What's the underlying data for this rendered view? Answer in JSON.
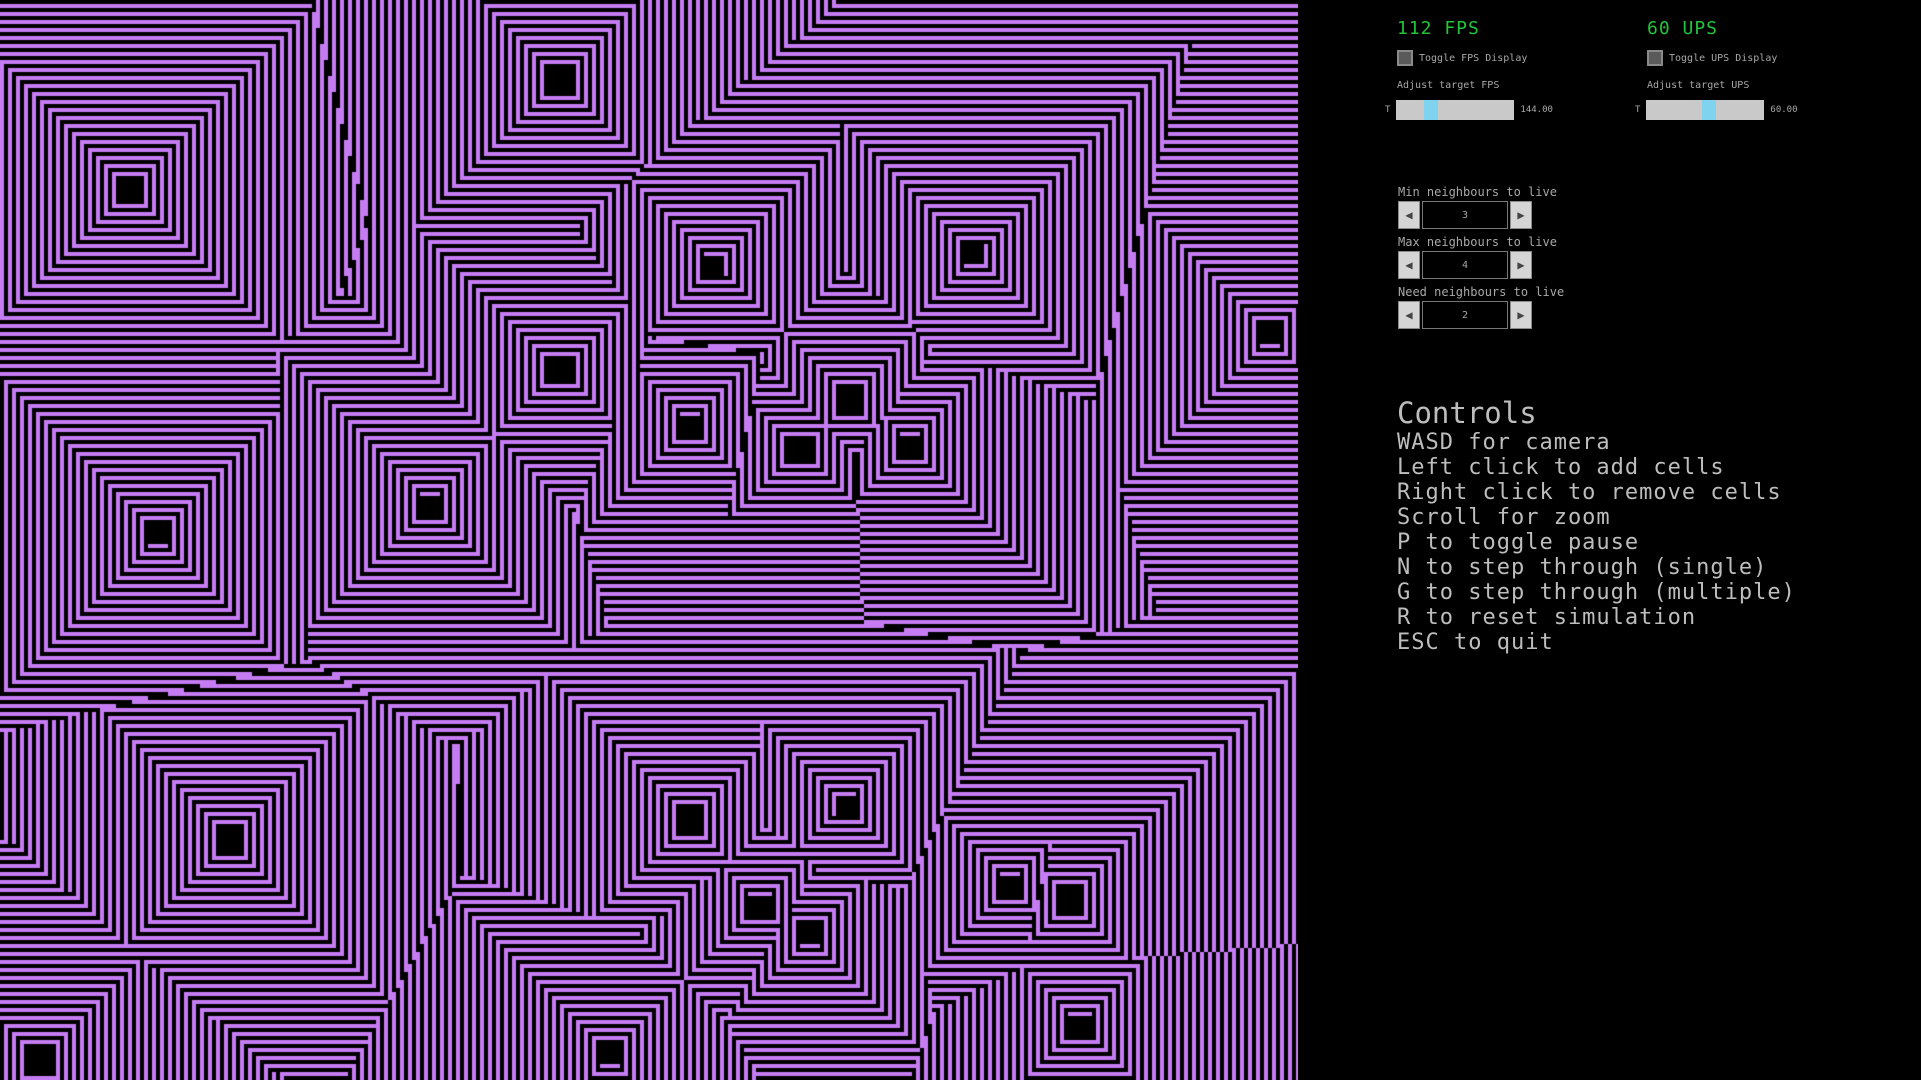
{
  "simulation": {
    "cell_color": "#c57cf2",
    "background_color": "#000000"
  },
  "fps_panel": {
    "readout": "112 FPS",
    "toggle_label": "Toggle FPS Display",
    "adjust_label": "Adjust target FPS",
    "slider_left": "T",
    "slider_value": "144.00",
    "slider_fraction": 0.27
  },
  "ups_panel": {
    "readout": "60 UPS",
    "toggle_label": "Toggle UPS Display",
    "adjust_label": "Adjust target UPS",
    "slider_left": "T",
    "slider_value": "60.00",
    "slider_fraction": 0.54
  },
  "rules": {
    "min": {
      "label": "Min neighbours to live",
      "value": "3",
      "left_icon": "arrow-left-icon",
      "right_icon": "arrow-right-icon"
    },
    "max": {
      "label": "Max neighbours to live",
      "value": "4",
      "left_icon": "arrow-left-icon",
      "right_icon": "arrow-right-icon"
    },
    "need": {
      "label": "Need neighbours to live",
      "value": "2",
      "left_icon": "arrow-left-icon",
      "right_icon": "arrow-right-icon"
    }
  },
  "controls": {
    "title": "Controls",
    "items": [
      "WASD for camera",
      "Left click to add cells",
      "Right click to remove cells",
      "Scroll for zoom",
      "P to toggle pause",
      "N to step through (single)",
      "G to step through (multiple)",
      "R to reset simulation",
      "ESC to quit"
    ]
  },
  "colors": {
    "fps_text": "#21c43a",
    "slider_knob": "#7fd3ef",
    "text": "#a8a8a8"
  }
}
